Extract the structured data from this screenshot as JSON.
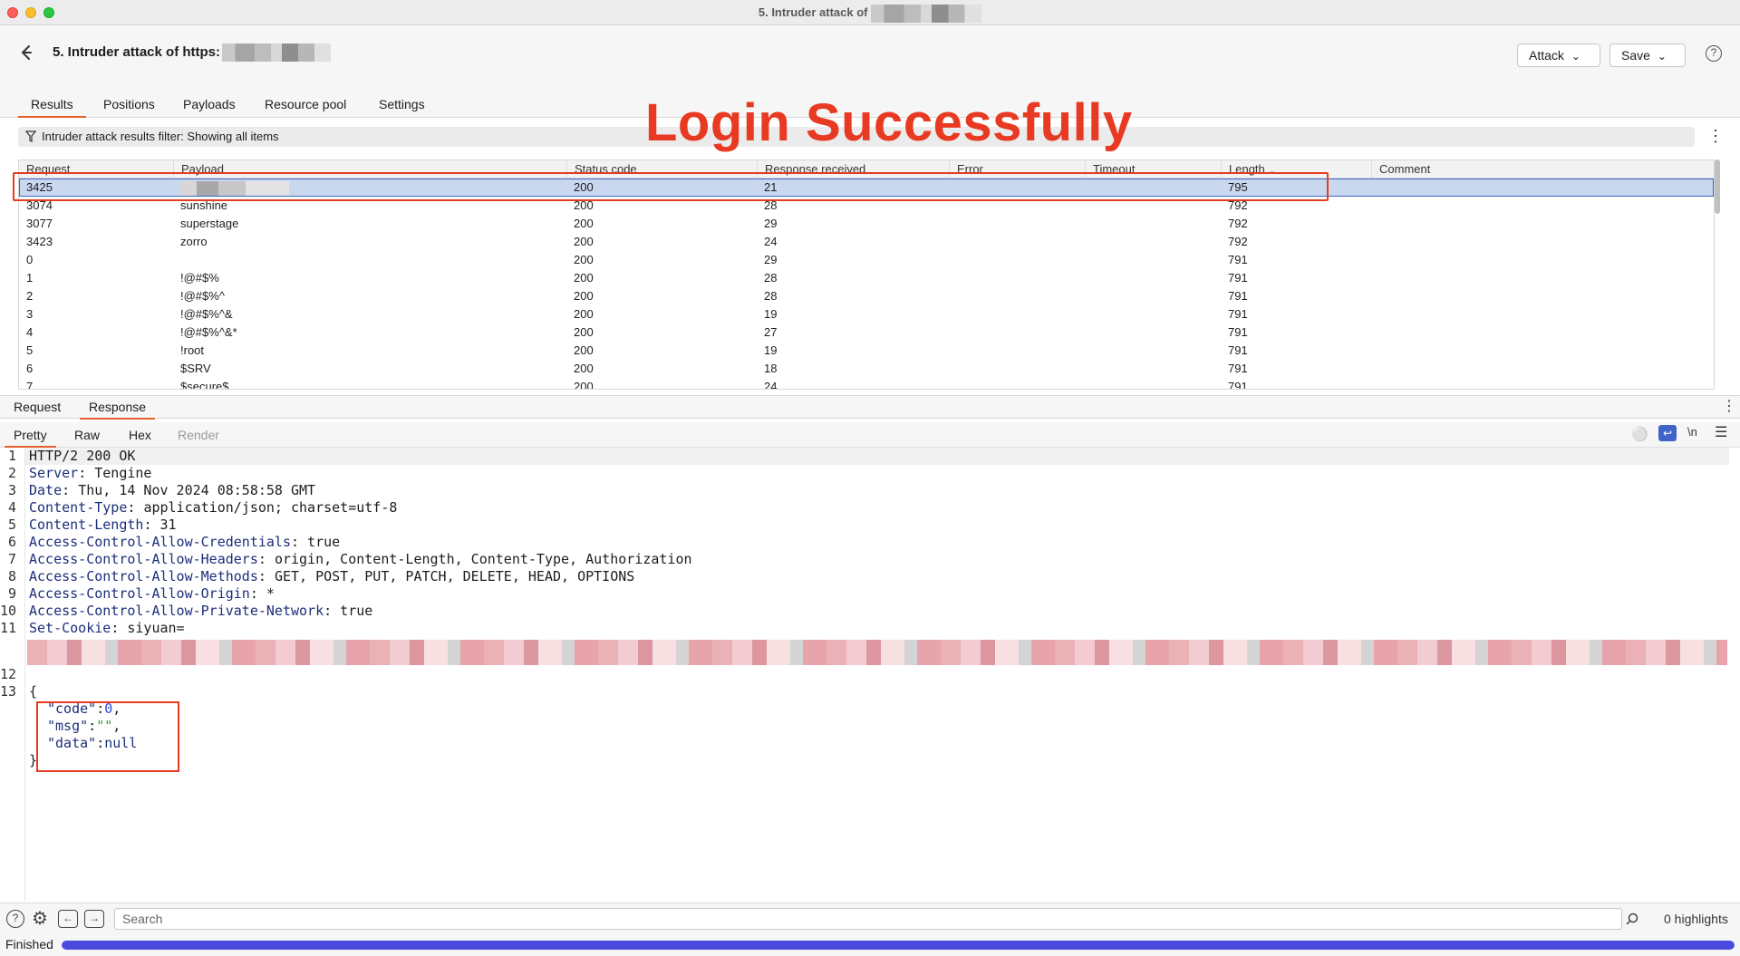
{
  "window": {
    "title": "5. Intruder attack of"
  },
  "header": {
    "title": "5. Intruder attack of https:",
    "attack_label": "Attack",
    "save_label": "Save"
  },
  "tabs": [
    "Results",
    "Positions",
    "Payloads",
    "Resource pool",
    "Settings"
  ],
  "filter": {
    "text": "Intruder attack results filter: Showing all items"
  },
  "annotation": {
    "title": "Login Successfully"
  },
  "table": {
    "columns": [
      "Request",
      "Payload",
      "Status code",
      "Response received",
      "Error",
      "Timeout",
      "Length",
      "Comment"
    ],
    "rows": [
      [
        "3425",
        "",
        "200",
        "21",
        "",
        "",
        "795",
        ""
      ],
      [
        "3074",
        "sunshine",
        "200",
        "28",
        "",
        "",
        "792",
        ""
      ],
      [
        "3077",
        "superstage",
        "200",
        "29",
        "",
        "",
        "792",
        ""
      ],
      [
        "3423",
        "zorro",
        "200",
        "24",
        "",
        "",
        "792",
        ""
      ],
      [
        "0",
        "",
        "200",
        "29",
        "",
        "",
        "791",
        ""
      ],
      [
        "1",
        "!@#$%",
        "200",
        "28",
        "",
        "",
        "791",
        ""
      ],
      [
        "2",
        "!@#$%^",
        "200",
        "28",
        "",
        "",
        "791",
        ""
      ],
      [
        "3",
        "!@#$%^&",
        "200",
        "19",
        "",
        "",
        "791",
        ""
      ],
      [
        "4",
        "!@#$%^&*",
        "200",
        "27",
        "",
        "",
        "791",
        ""
      ],
      [
        "5",
        "!root",
        "200",
        "19",
        "",
        "",
        "791",
        ""
      ],
      [
        "6",
        "$SRV",
        "200",
        "18",
        "",
        "",
        "791",
        ""
      ],
      [
        "7",
        "$secure$",
        "200",
        "24",
        "",
        "",
        "791",
        ""
      ]
    ]
  },
  "pane": {
    "tabs": [
      "Request",
      "Response"
    ],
    "views": [
      "Pretty",
      "Raw",
      "Hex",
      "Render"
    ],
    "newline_label": "\\n"
  },
  "response": {
    "status_line": "HTTP/2 200 OK",
    "headers": [
      [
        "Server",
        "Tengine"
      ],
      [
        "Date",
        "Thu, 14 Nov 2024 08:58:58 GMT"
      ],
      [
        "Content-Type",
        "application/json; charset=utf-8"
      ],
      [
        "Content-Length",
        "31"
      ],
      [
        "Access-Control-Allow-Credentials",
        "true"
      ],
      [
        "Access-Control-Allow-Headers",
        "origin, Content-Length, Content-Type, Authorization"
      ],
      [
        "Access-Control-Allow-Methods",
        "GET, POST, PUT, PATCH, DELETE, HEAD, OPTIONS"
      ],
      [
        "Access-Control-Allow-Origin",
        "*"
      ],
      [
        "Access-Control-Allow-Private-Network",
        "true"
      ],
      [
        "Set-Cookie",
        "siyuan="
      ]
    ],
    "body_open": "{",
    "body_close": "}",
    "json": {
      "code_key": "\"code\"",
      "code_val": "0",
      "msg_key": "\"msg\"",
      "msg_val": "\"\"",
      "data_key": "\"data\"",
      "data_val": "null"
    }
  },
  "bottom": {
    "search_placeholder": "Search",
    "highlights": "0 highlights"
  },
  "status": {
    "text": "Finished",
    "progress": 1.0
  }
}
